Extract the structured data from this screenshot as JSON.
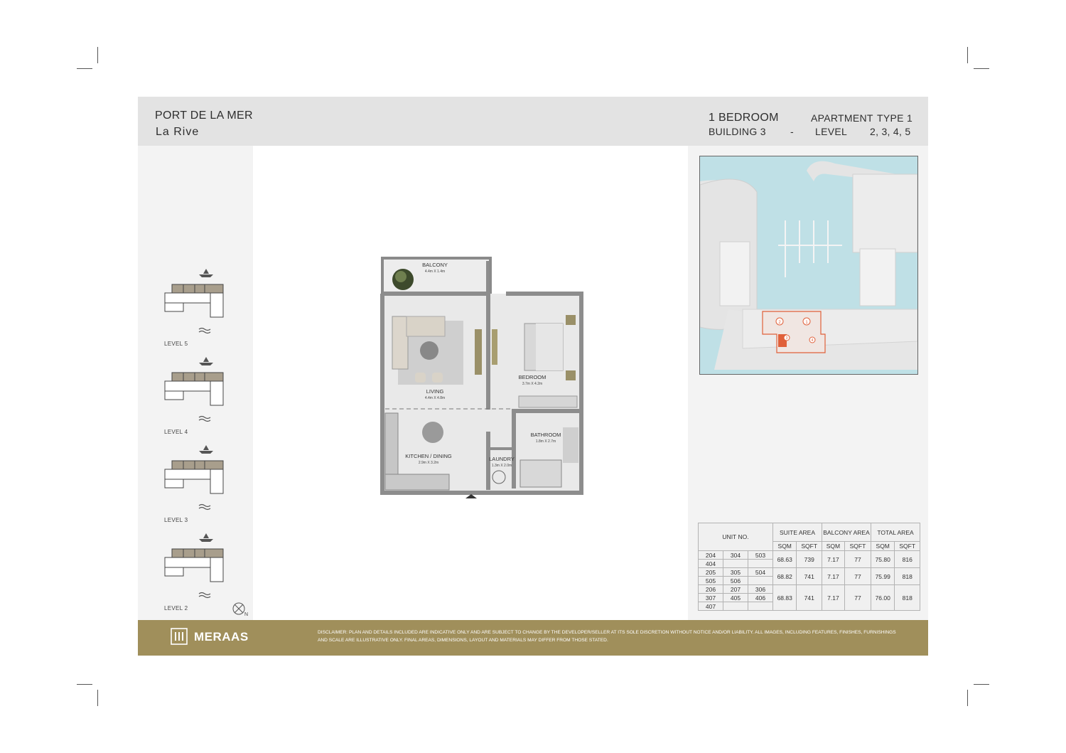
{
  "header": {
    "project": "PORT DE LA MER",
    "subtitle": "La Rive",
    "unit_type": "1 BEDROOM",
    "apartment_label": "APARTMENT",
    "type_label": "TYPE 1",
    "building": "BUILDING 3",
    "separator": "-",
    "level_label": "LEVEL",
    "levels": "2, 3, 4, 5"
  },
  "key_plans": [
    {
      "label": "LEVEL 5"
    },
    {
      "label": "LEVEL 4"
    },
    {
      "label": "LEVEL 3"
    },
    {
      "label": "LEVEL 2"
    }
  ],
  "north": "N",
  "rooms": {
    "balcony": {
      "name": "BALCONY",
      "size": "4.4m X 1.4m"
    },
    "living": {
      "name": "LIVING",
      "size": "4.4m X 4.8m"
    },
    "bedroom": {
      "name": "BEDROOM",
      "size": "3.7m X 4.2m"
    },
    "bathroom": {
      "name": "BATHROOM",
      "size": "1.8m X 2.7m"
    },
    "kitchen": {
      "name": "KITCHEN / DINING",
      "size": "2.9m X 3.2m"
    },
    "laundry": {
      "name": "LAUNDRY",
      "size": "1.3m X 2.0m"
    }
  },
  "site_map": {
    "markers": [
      "1",
      "2",
      "3",
      "4"
    ],
    "highlight_color": "#e0603a",
    "water_color": "#bfe0e6"
  },
  "area_table": {
    "unit_header": "UNIT NO.",
    "groups": [
      "SUITE AREA",
      "BALCONY AREA",
      "TOTAL AREA"
    ],
    "sub": [
      "SQM",
      "SQFT",
      "SQM",
      "SQFT",
      "SQM",
      "SQFT"
    ],
    "rows": [
      {
        "units": [
          [
            "204",
            "304",
            "503"
          ],
          [
            "404",
            "",
            ""
          ]
        ],
        "values": [
          "68.63",
          "739",
          "7.17",
          "77",
          "75.80",
          "816"
        ]
      },
      {
        "units": [
          [
            "205",
            "305",
            "504"
          ],
          [
            "505",
            "506",
            ""
          ]
        ],
        "values": [
          "68.82",
          "741",
          "7.17",
          "77",
          "75.99",
          "818"
        ]
      },
      {
        "units": [
          [
            "206",
            "207",
            "306"
          ],
          [
            "307",
            "405",
            "406"
          ],
          [
            "407",
            "",
            ""
          ]
        ],
        "values": [
          "68.83",
          "741",
          "7.17",
          "77",
          "76.00",
          "818"
        ]
      }
    ]
  },
  "footer": {
    "brand": "MERAAS",
    "brand_color": "#a08f5b",
    "disclaimer": "DISCLAIMER: PLAN AND DETAILS INCLUDED ARE INDICATIVE ONLY AND ARE SUBJECT TO CHANGE BY THE DEVELOPER/SELLER AT ITS SOLE DISCRETION WITHOUT NOTICE AND/OR LIABILITY. ALL IMAGES, INCLUDING FEATURES, FINISHES, FURNISHINGS AND SCALE ARE ILLUSTRATIVE ONLY. FINAL AREAS, DIMENSIONS, LAYOUT AND MATERIALS MAY DIFFER FROM THOSE STATED."
  }
}
